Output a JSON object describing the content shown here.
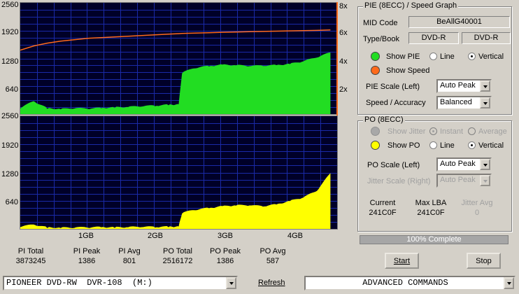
{
  "pie_chart": {
    "y_ticks": [
      "2560",
      "1920",
      "1280",
      "640"
    ],
    "speed_ticks": [
      "8x",
      "6x",
      "4x",
      "2x"
    ],
    "chart_data": {
      "type": "area",
      "title": "",
      "x": [
        0.0,
        0.2,
        0.4,
        0.6,
        0.8,
        1.0,
        1.2,
        1.4,
        1.6,
        1.8,
        2.0,
        2.2,
        2.35,
        2.4,
        2.6,
        2.8,
        3.0,
        3.2,
        3.4,
        3.6,
        3.8,
        4.0,
        4.2,
        4.4,
        4.6
      ],
      "series": [
        {
          "name": "Show PIE",
          "values": [
            130,
            280,
            120,
            100,
            120,
            110,
            125,
            140,
            150,
            165,
            180,
            200,
            210,
            940,
            1050,
            1090,
            1120,
            1110,
            1090,
            1100,
            1110,
            1140,
            1200,
            1290,
            1400
          ]
        },
        {
          "name": "Show Speed",
          "values": [
            4.6,
            4.9,
            5.1,
            5.25,
            5.35,
            5.45,
            5.5,
            5.55,
            5.6,
            5.65,
            5.7,
            5.75,
            5.78,
            5.8,
            5.82,
            5.85,
            5.88,
            5.9,
            5.92,
            5.94,
            5.96,
            5.98,
            6.0,
            6.02,
            6.05
          ]
        }
      ],
      "ylim": [
        0,
        2560
      ],
      "y2lim": [
        0,
        8
      ],
      "xlim": [
        0,
        4.7
      ]
    }
  },
  "po_chart": {
    "y_ticks": [
      "2560",
      "1920",
      "1280",
      "640"
    ],
    "x_ticks": [
      "1GB",
      "2GB",
      "3GB",
      "4GB"
    ],
    "chart_data": {
      "type": "area",
      "title": "",
      "x": [
        0.0,
        0.2,
        0.4,
        0.6,
        0.8,
        1.0,
        1.2,
        1.4,
        1.6,
        1.8,
        2.0,
        2.2,
        2.35,
        2.4,
        2.6,
        2.8,
        3.0,
        3.2,
        3.4,
        3.6,
        3.8,
        4.0,
        4.2,
        4.4,
        4.6
      ],
      "series": [
        {
          "name": "Show PO",
          "values": [
            40,
            80,
            20,
            10,
            15,
            20,
            25,
            20,
            25,
            30,
            30,
            35,
            40,
            350,
            420,
            460,
            500,
            520,
            520,
            500,
            540,
            620,
            700,
            850,
            1250
          ]
        }
      ],
      "ylim": [
        0,
        2560
      ],
      "xlim": [
        0,
        4.7
      ]
    }
  },
  "stats": [
    {
      "label": "PI Total",
      "value": "3873245"
    },
    {
      "label": "PI Peak",
      "value": "1386"
    },
    {
      "label": "PI Avg",
      "value": "801"
    },
    {
      "label": "PO Total",
      "value": "2516172"
    },
    {
      "label": "PO Peak",
      "value": "1386"
    },
    {
      "label": "PO Avg",
      "value": "587"
    }
  ],
  "pie_panel": {
    "title": "PIE (8ECC) / Speed Graph",
    "mid_label": "MID Code",
    "mid_value": "BeAllG40001",
    "type_label": "Type/Book",
    "type_value": "DVD-R",
    "book_value": "DVD-R",
    "show_pie": "Show PIE",
    "show_speed": "Show Speed",
    "line": "Line",
    "vertical": "Vertical",
    "scale_label": "PIE Scale (Left)",
    "scale_value": "Auto Peak",
    "accuracy_label": "Speed / Accuracy",
    "accuracy_value": "Balanced",
    "pie_color": "#22dd22",
    "speed_color": "#ff6a1a"
  },
  "po_panel": {
    "title": "PO (8ECC)",
    "show_jitter": "Show Jitter",
    "instant": "Instant",
    "average": "Average",
    "show_po": "Show PO",
    "line": "Line",
    "vertical": "Vertical",
    "scale_label": "PO Scale (Left)",
    "scale_value": "Auto Peak",
    "jitter_label": "Jitter Scale (Right)",
    "jitter_value": "Auto Peak",
    "current_label": "Current",
    "current_value": "241C0F",
    "maxlba_label": "Max LBA",
    "maxlba_value": "241C0F",
    "jitter_avg_label": "Jitter Avg",
    "jitter_avg_value": "0",
    "po_color": "#ffff00"
  },
  "progress": {
    "text": "100% Complete",
    "fraction": 1.0
  },
  "buttons": {
    "start": "Start",
    "stop": "Stop",
    "refresh": "Refresh"
  },
  "drive": {
    "value": "PIONEER DVD-RW  DVR-108  (M:)"
  },
  "commands": {
    "value": "ADVANCED COMMANDS"
  }
}
